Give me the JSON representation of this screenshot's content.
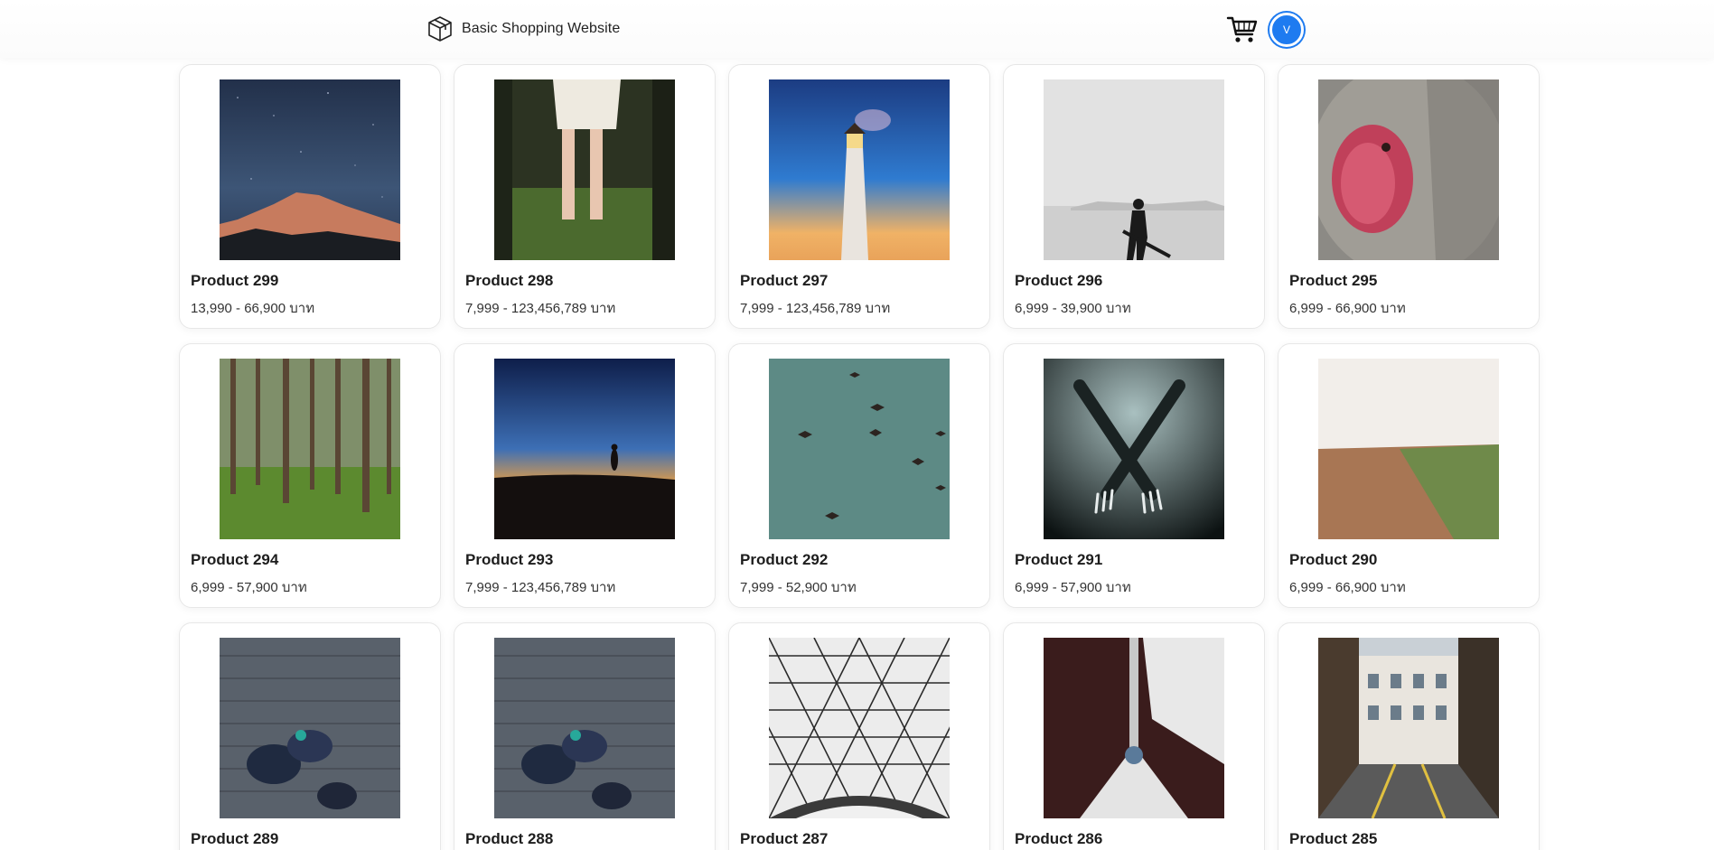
{
  "header": {
    "title": "Basic Shopping Website",
    "logo_icon": "box-icon",
    "cart_icon": "cart-icon",
    "avatar_initial": "V",
    "accent_color": "#1e7bf0"
  },
  "products": [
    {
      "name": "Product 299",
      "price": "13,990 - 66,900 บาท",
      "image": "night-sky-mountain"
    },
    {
      "name": "Product 298",
      "price": "7,999 - 123,456,789 บาท",
      "image": "girl-white-dress-forest"
    },
    {
      "name": "Product 297",
      "price": "7,999 - 123,456,789 บาท",
      "image": "lighthouse-night"
    },
    {
      "name": "Product 296",
      "price": "6,999 - 39,900 บาท",
      "image": "guitarist-desert-bw"
    },
    {
      "name": "Product 295",
      "price": "6,999 - 66,900 บาท",
      "image": "snow-monkey"
    },
    {
      "name": "Product 294",
      "price": "6,999 - 57,900 บาท",
      "image": "pine-forest"
    },
    {
      "name": "Product 293",
      "price": "7,999 - 123,456,789 บาท",
      "image": "silhouette-sunset"
    },
    {
      "name": "Product 292",
      "price": "7,999 - 52,900 บาท",
      "image": "birds-teal-sky"
    },
    {
      "name": "Product 291",
      "price": "6,999 - 57,900 บาท",
      "image": "forks-dark"
    },
    {
      "name": "Product 290",
      "price": "6,999 - 66,900 บาท",
      "image": "field-landscape"
    },
    {
      "name": "Product 289",
      "price": "",
      "image": "people-on-boardwalk"
    },
    {
      "name": "Product 288",
      "price": "",
      "image": "people-on-boardwalk"
    },
    {
      "name": "Product 287",
      "price": "",
      "image": "glass-dome-roof"
    },
    {
      "name": "Product 286",
      "price": "",
      "image": "sailboat-bow"
    },
    {
      "name": "Product 285",
      "price": "",
      "image": "city-street"
    }
  ]
}
